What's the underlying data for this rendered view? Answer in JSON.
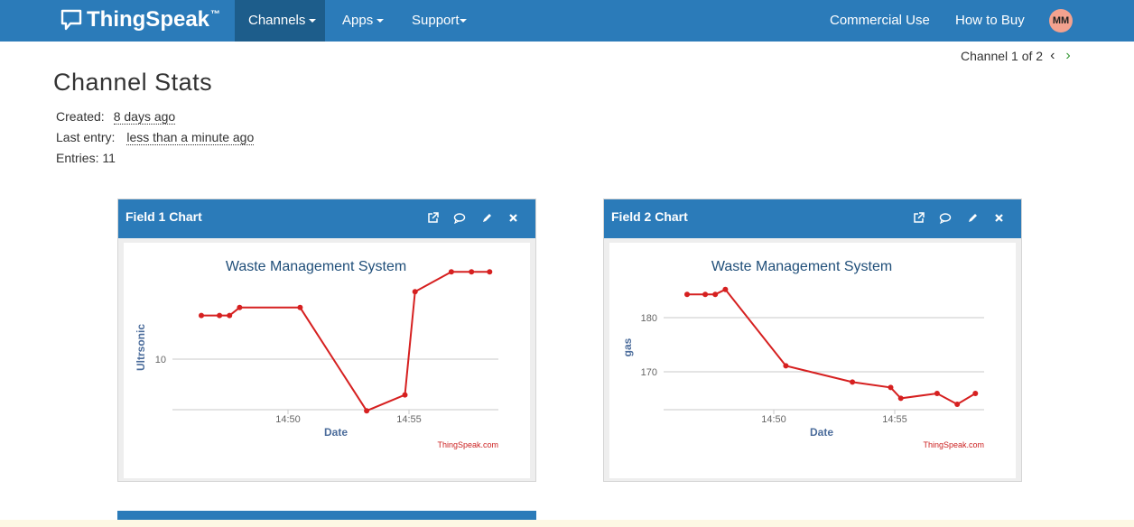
{
  "nav": {
    "brand": "ThingSpeak",
    "brand_tm": "™",
    "items": [
      {
        "label": "Channels"
      },
      {
        "label": "Apps"
      },
      {
        "label": "Support"
      }
    ],
    "right": [
      {
        "label": "Commercial Use"
      },
      {
        "label": "How to Buy"
      }
    ],
    "avatar": "MM"
  },
  "pager": {
    "label": "Channel 1 of 2",
    "prev": "‹",
    "next": "›"
  },
  "stats": {
    "title": "Channel Stats",
    "created_label": "Created:",
    "created_value": "8 days ago",
    "last_label": "Last entry:",
    "last_value": "less than a minute ago",
    "entries_label": "Entries: 11"
  },
  "panels": [
    {
      "title": "Field 1 Chart"
    },
    {
      "title": "Field 2 Chart"
    }
  ],
  "colors": {
    "nav": "#2b7bb9",
    "nav_active": "#1d5d8b",
    "series": "#d62020",
    "title": "#1f4e79"
  },
  "chart_data": [
    {
      "type": "line",
      "title": "Waste Management System",
      "xlabel": "Date",
      "ylabel": "Ultrsonic",
      "credit": "ThingSpeak.com",
      "x_ticks": [
        "14:50",
        "14:55"
      ],
      "y_ticks": [
        "10"
      ],
      "grid": true,
      "series": [
        {
          "x": [
            "14:46:25",
            "14:47:10",
            "14:47:35",
            "14:48:00",
            "14:50:30",
            "14:53:15",
            "14:54:50",
            "14:55:15",
            "14:56:45",
            "14:57:35",
            "14:58:20"
          ],
          "values": [
            15.5,
            15.5,
            15.5,
            16.5,
            16.5,
            3.5,
            5.5,
            18.5,
            21.0,
            21.0,
            21.0
          ]
        }
      ]
    },
    {
      "type": "line",
      "title": "Waste Management System",
      "xlabel": "Date",
      "ylabel": "gas",
      "credit": "ThingSpeak.com",
      "x_ticks": [
        "14:50",
        "14:55"
      ],
      "y_ticks": [
        "170",
        "180"
      ],
      "grid": true,
      "series": [
        {
          "x": [
            "14:46:25",
            "14:47:10",
            "14:47:35",
            "14:48:00",
            "14:50:30",
            "14:53:15",
            "14:54:50",
            "14:55:15",
            "14:56:45",
            "14:57:35",
            "14:58:20"
          ],
          "values": [
            184.3,
            184.3,
            184.3,
            185.2,
            171.1,
            168.1,
            167.1,
            165.1,
            166.0,
            164.0,
            166.0
          ]
        }
      ]
    }
  ]
}
